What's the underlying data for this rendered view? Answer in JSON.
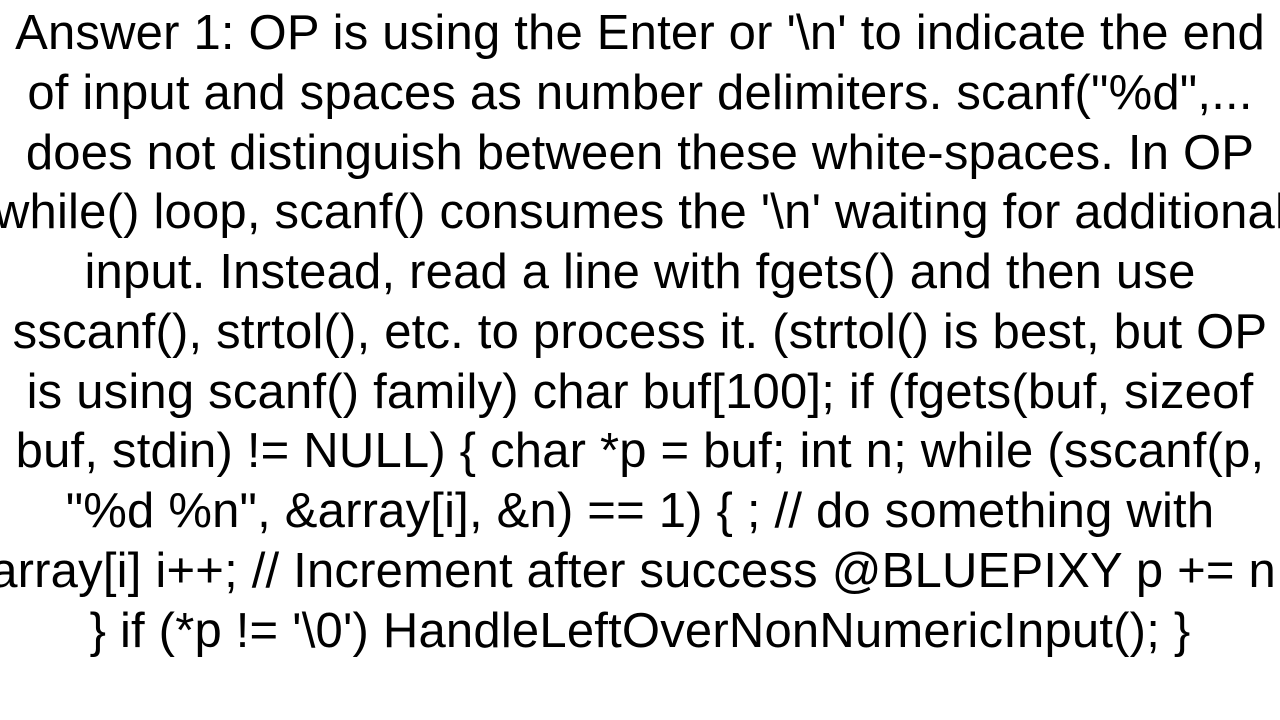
{
  "document": {
    "answer_text": "Answer 1: OP is using the Enter or '\\n' to indicate the end of input and spaces as number delimiters.  scanf(\"%d\",... does not distinguish between these white-spaces.  In OP while() loop, scanf() consumes the '\\n' waiting for additional input. Instead, read a line with fgets() and then use sscanf(), strtol(), etc. to process it.  (strtol() is best, but OP is using scanf() family) char buf[100]; if (fgets(buf, sizeof buf, stdin) != NULL) {   char *p = buf;   int n;   while (sscanf(p, \"%d %n\", &array[i], &n) == 1) {      ; // do something with array[i]      i++;  // Increment after success @BLUEPIXY      p += n;   }   if (*p != '\\0') HandleLeftOverNonNumericInput(); }"
  }
}
